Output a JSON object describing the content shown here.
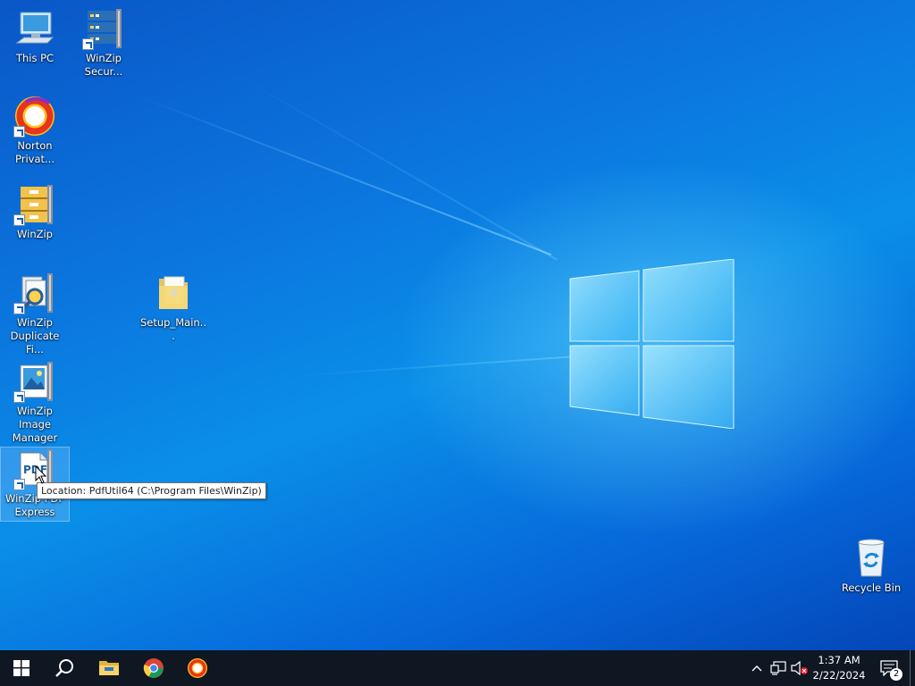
{
  "desktop": {
    "icons": [
      {
        "label": "This PC",
        "icon": "this-pc-icon"
      },
      {
        "label": "WinZip Secur...",
        "icon": "winzip-secure-backup-icon"
      },
      {
        "label": "Norton Privat...",
        "icon": "norton-private-browser-icon"
      },
      {
        "label": "WinZip",
        "icon": "winzip-icon"
      },
      {
        "label": "WinZip Duplicate Fi...",
        "icon": "winzip-duplicate-finder-icon"
      },
      {
        "label": "Setup_Main...",
        "icon": "folder-icon"
      },
      {
        "label": "WinZip Image Manager",
        "icon": "winzip-image-manager-icon"
      },
      {
        "label": "WinZip PDF Express",
        "icon": "winzip-pdf-express-icon"
      },
      {
        "label": "Recycle Bin",
        "icon": "recycle-bin-icon"
      }
    ],
    "tooltip": "Location: PdfUtil64 (C:\\Program Files\\WinZip)",
    "pdf_badge": "PDF"
  },
  "taskbar": {
    "apps": [
      {
        "name": "start-button",
        "icon": "windows-icon"
      },
      {
        "name": "search-button",
        "icon": "search-icon"
      },
      {
        "name": "file-explorer",
        "icon": "folder-icon"
      },
      {
        "name": "chrome",
        "icon": "chrome-icon"
      },
      {
        "name": "norton-private-browser",
        "icon": "norton-icon"
      }
    ],
    "clock": {
      "time": "1:37 AM",
      "date": "2/22/2024"
    },
    "notifications_count": "2"
  },
  "colors": {
    "taskbar": "#0f1722",
    "accent": "#0a78e0"
  }
}
